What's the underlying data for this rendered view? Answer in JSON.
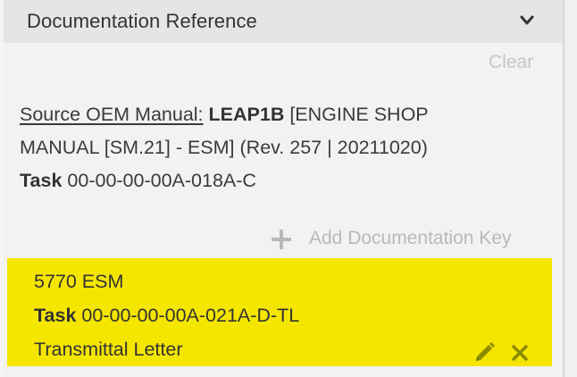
{
  "section": {
    "title": "Documentation Reference",
    "clear_label": "Clear"
  },
  "source": {
    "label": "Source OEM Manual:",
    "engine": "LEAP1B",
    "manual_line1": "[ENGINE SHOP",
    "manual_line2": "MANUAL [SM.21] - ESM] (Rev. 257 | 20211020)",
    "task_label": "Task",
    "task_value": "00-00-00-00A-018A-C"
  },
  "add_key": {
    "label": "Add Documentation Key"
  },
  "doc_key": {
    "reference": "5770 ESM",
    "task_label": "Task",
    "task_value": "00-00-00-00A-021A-D-TL",
    "description": "Transmittal Letter"
  },
  "colors": {
    "highlight": "#f5e600",
    "header_bg": "#e5e5e5",
    "muted_text": "#c7c7c7",
    "icon_gray": "#b9b9b9"
  },
  "icons": {
    "collapse": "chevron-down-icon",
    "add": "plus-icon",
    "edit": "pencil-icon",
    "delete": "close-icon"
  }
}
